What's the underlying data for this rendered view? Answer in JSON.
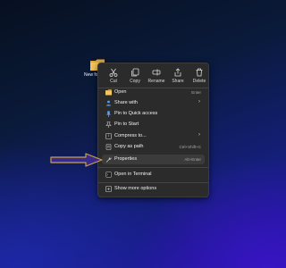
{
  "desktop": {
    "icon_label": "New fo"
  },
  "toolbar": [
    {
      "label": "Cut",
      "icon": "scissors-icon"
    },
    {
      "label": "Copy",
      "icon": "copy-icon"
    },
    {
      "label": "Rename",
      "icon": "rename-icon"
    },
    {
      "label": "Share",
      "icon": "share-icon"
    },
    {
      "label": "Delete",
      "icon": "trash-icon"
    }
  ],
  "menu": {
    "items": [
      {
        "label": "Open",
        "shortcut": "Enter",
        "icon": "folder-icon"
      },
      {
        "label": "Share with",
        "submenu": true,
        "icon": "share-with-icon"
      },
      {
        "label": "Pin to Quick access",
        "icon": "pin-icon"
      },
      {
        "label": "Pin to Start",
        "icon": "pin-start-icon"
      },
      {
        "label": "Compress to...",
        "submenu": true,
        "icon": "zip-icon"
      },
      {
        "label": "Copy as path",
        "shortcut": "Ctrl+Shift+C",
        "icon": "copy-path-icon"
      },
      {
        "label": "Properties",
        "shortcut": "Alt+Enter",
        "icon": "properties-icon"
      },
      {
        "label": "Open in Terminal",
        "icon": "terminal-icon"
      },
      {
        "label": "Show more options",
        "icon": "more-options-icon"
      }
    ]
  },
  "colors": {
    "menu_bg": "#2b2b2b",
    "highlight": "#3b3b3b",
    "arrow_fill": "#3a2a8a",
    "arrow_stroke": "#c9a24a"
  }
}
